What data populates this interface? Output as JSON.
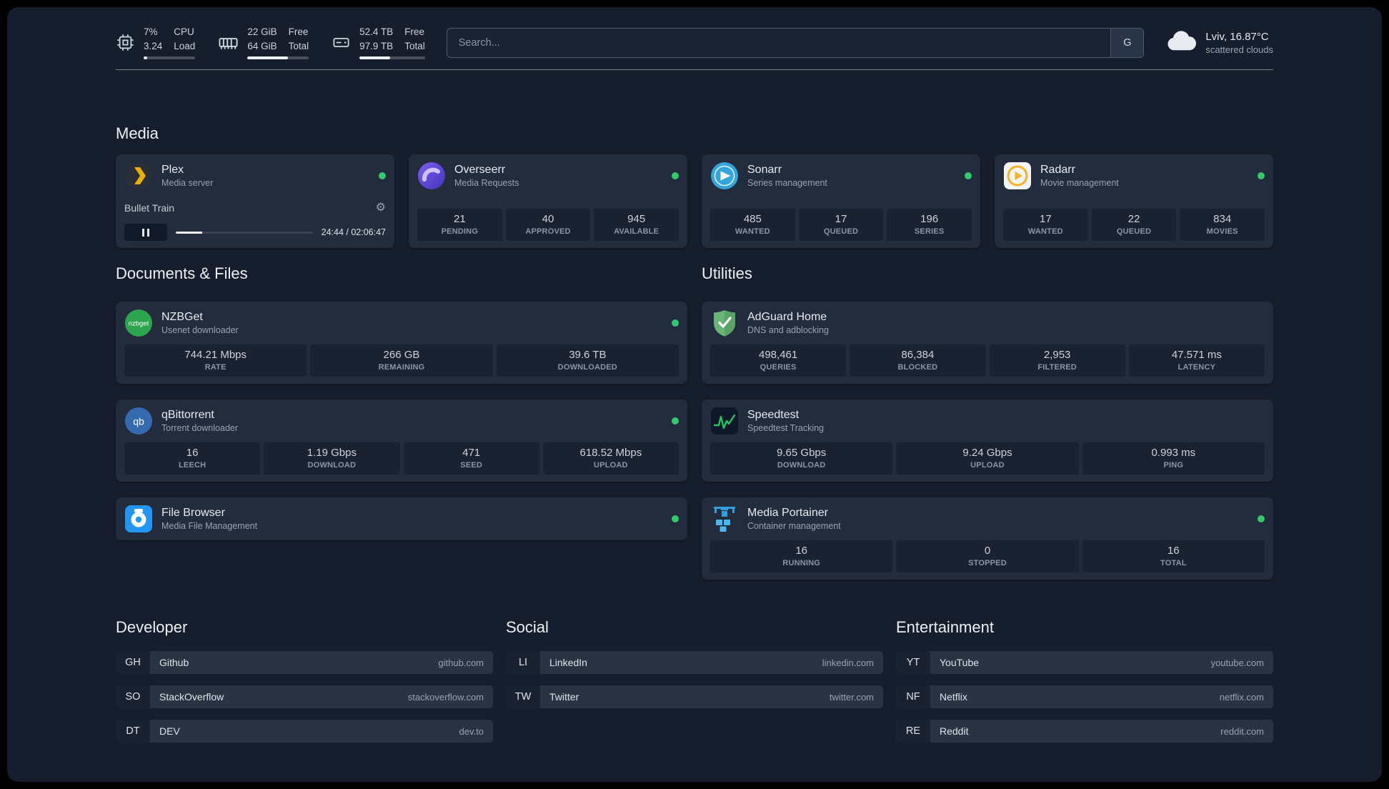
{
  "topbar": {
    "cpu": {
      "value_top": "7%",
      "value_bottom": "3.24",
      "label_top": "CPU",
      "label_bottom": "Load",
      "bar": 7
    },
    "memory": {
      "value_top": "22 GiB",
      "value_bottom": "64 GiB",
      "label_top": "Free",
      "label_bottom": "Total",
      "bar": 66
    },
    "disk": {
      "value_top": "52.4 TB",
      "value_bottom": "97.9 TB",
      "label_top": "Free",
      "label_bottom": "Total",
      "bar": 47
    },
    "search": {
      "placeholder": "Search...",
      "provider": "G"
    },
    "weather": {
      "location": "Lviv, 16.87°C",
      "condition": "scattered clouds"
    }
  },
  "sections": {
    "media": {
      "title": "Media"
    },
    "documents": {
      "title": "Documents & Files"
    },
    "utilities": {
      "title": "Utilities"
    },
    "developer": {
      "title": "Developer"
    },
    "social": {
      "title": "Social"
    },
    "entertainment": {
      "title": "Entertainment"
    }
  },
  "services": {
    "plex": {
      "name": "Plex",
      "desc": "Media server",
      "now_playing": "Bullet Train",
      "time": "24:44 / 02:06:47",
      "progress": 19.5
    },
    "overseerr": {
      "name": "Overseerr",
      "desc": "Media Requests",
      "stats": [
        {
          "value": "21",
          "label": "PENDING"
        },
        {
          "value": "40",
          "label": "APPROVED"
        },
        {
          "value": "945",
          "label": "AVAILABLE"
        }
      ]
    },
    "sonarr": {
      "name": "Sonarr",
      "desc": "Series management",
      "stats": [
        {
          "value": "485",
          "label": "WANTED"
        },
        {
          "value": "17",
          "label": "QUEUED"
        },
        {
          "value": "196",
          "label": "SERIES"
        }
      ]
    },
    "radarr": {
      "name": "Radarr",
      "desc": "Movie management",
      "stats": [
        {
          "value": "17",
          "label": "WANTED"
        },
        {
          "value": "22",
          "label": "QUEUED"
        },
        {
          "value": "834",
          "label": "MOVIES"
        }
      ]
    },
    "nzbget": {
      "name": "NZBGet",
      "desc": "Usenet downloader",
      "icon_text": "nzbget",
      "stats": [
        {
          "value": "744.21 Mbps",
          "label": "RATE"
        },
        {
          "value": "266 GB",
          "label": "REMAINING"
        },
        {
          "value": "39.6 TB",
          "label": "DOWNLOADED"
        }
      ]
    },
    "qbittorrent": {
      "name": "qBittorrent",
      "desc": "Torrent downloader",
      "icon_text": "qb",
      "stats": [
        {
          "value": "16",
          "label": "LEECH"
        },
        {
          "value": "1.19 Gbps",
          "label": "DOWNLOAD"
        },
        {
          "value": "471",
          "label": "SEED"
        },
        {
          "value": "618.52 Mbps",
          "label": "UPLOAD"
        }
      ]
    },
    "filebrowser": {
      "name": "File Browser",
      "desc": "Media File Management"
    },
    "adguard": {
      "name": "AdGuard Home",
      "desc": "DNS and adblocking",
      "stats": [
        {
          "value": "498,461",
          "label": "QUERIES"
        },
        {
          "value": "86,384",
          "label": "BLOCKED"
        },
        {
          "value": "2,953",
          "label": "FILTERED"
        },
        {
          "value": "47.571 ms",
          "label": "LATENCY"
        }
      ]
    },
    "speedtest": {
      "name": "Speedtest",
      "desc": "Speedtest Tracking",
      "stats": [
        {
          "value": "9.65 Gbps",
          "label": "DOWNLOAD"
        },
        {
          "value": "9.24 Gbps",
          "label": "UPLOAD"
        },
        {
          "value": "0.993 ms",
          "label": "PING"
        }
      ]
    },
    "portainer": {
      "name": "Media Portainer",
      "desc": "Container management",
      "stats": [
        {
          "value": "16",
          "label": "RUNNING"
        },
        {
          "value": "0",
          "label": "STOPPED"
        },
        {
          "value": "16",
          "label": "TOTAL"
        }
      ]
    }
  },
  "bookmarks": {
    "developer": [
      {
        "abbr": "GH",
        "name": "Github",
        "url": "github.com"
      },
      {
        "abbr": "SO",
        "name": "StackOverflow",
        "url": "stackoverflow.com"
      },
      {
        "abbr": "DT",
        "name": "DEV",
        "url": "dev.to"
      }
    ],
    "social": [
      {
        "abbr": "LI",
        "name": "LinkedIn",
        "url": "linkedin.com"
      },
      {
        "abbr": "TW",
        "name": "Twitter",
        "url": "twitter.com"
      }
    ],
    "entertainment": [
      {
        "abbr": "YT",
        "name": "YouTube",
        "url": "youtube.com"
      },
      {
        "abbr": "NF",
        "name": "Netflix",
        "url": "netflix.com"
      },
      {
        "abbr": "RE",
        "name": "Reddit",
        "url": "reddit.com"
      }
    ]
  },
  "colors": {
    "accent_green": "#2fcb6e",
    "panel_bg": "#161d2c",
    "card_bg": "#232c3d",
    "tile_bg": "#1a2232"
  }
}
